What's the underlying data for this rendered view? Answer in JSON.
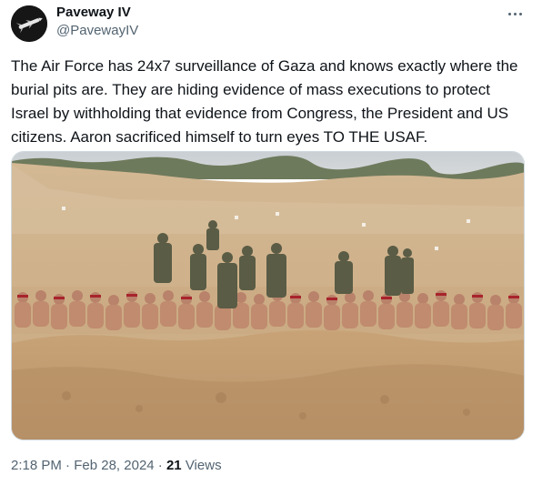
{
  "author": {
    "display_name": "Paveway IV",
    "handle": "@PavewayIV",
    "avatar_icon": "missile-icon"
  },
  "more_icon": "more-dots-icon",
  "tweet": {
    "text": "The Air Force has 24x7 surveillance of Gaza and knows exactly where the burial pits are. They are hiding evidence of mass executions to protect Israel by withholding that evidence from Congress, the President and US citizens. Aaron sacrificed himself to turn eyes TO THE USAF."
  },
  "meta": {
    "time": "2:18 PM",
    "separator": "·",
    "date": "Feb 28, 2024",
    "views_count": "21",
    "views_label": "Views"
  },
  "colors": {
    "text_primary": "#0f1419",
    "text_secondary": "#536471",
    "border": "#cfd9de"
  }
}
